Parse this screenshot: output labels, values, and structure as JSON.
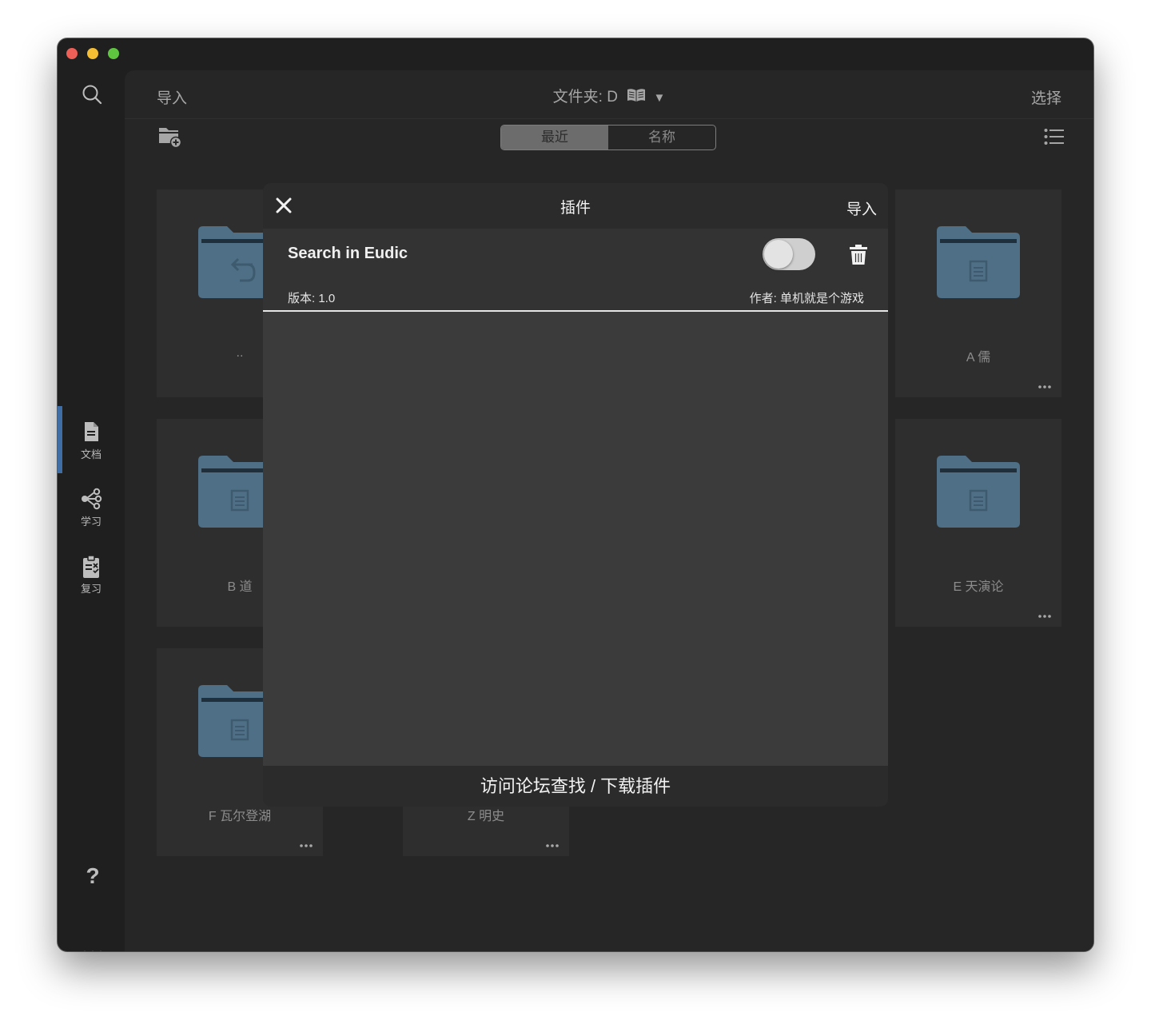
{
  "sidebar": {
    "items": [
      {
        "label": "文档",
        "icon": "document-icon",
        "active": true
      },
      {
        "label": "学习",
        "icon": "share-graph-icon",
        "active": false
      },
      {
        "label": "复习",
        "icon": "clipboard-icon",
        "active": false
      }
    ],
    "help_label": "?"
  },
  "header": {
    "import_label": "导入",
    "folder_label": "文件夹: D",
    "folder_caret": "▼",
    "select_label": "选择"
  },
  "sort": {
    "options": [
      "最近",
      "名称"
    ],
    "selected": "最近"
  },
  "folders": [
    {
      "name": "..",
      "icon": "folder-back-icon"
    },
    {
      "name": "A 儒",
      "icon": "folder-icon"
    },
    {
      "name": "B 道",
      "icon": "folder-icon"
    },
    {
      "name": "E 天演论",
      "icon": "folder-icon"
    },
    {
      "name": "F 瓦尔登湖",
      "icon": "folder-icon"
    },
    {
      "name": "Z 明史",
      "icon": "folder-icon"
    }
  ],
  "modal": {
    "title": "插件",
    "import_label": "导入",
    "plugin": {
      "name": "Search in Eudic",
      "version": "版本: 1.0",
      "author": "作者: 单机就是个游戏",
      "enabled": false
    },
    "footer": "访问论坛查找 / 下载插件"
  },
  "colors": {
    "folder": "#4e6f86",
    "active_indicator": "#3f6ea6",
    "window_bg": "#262626"
  }
}
